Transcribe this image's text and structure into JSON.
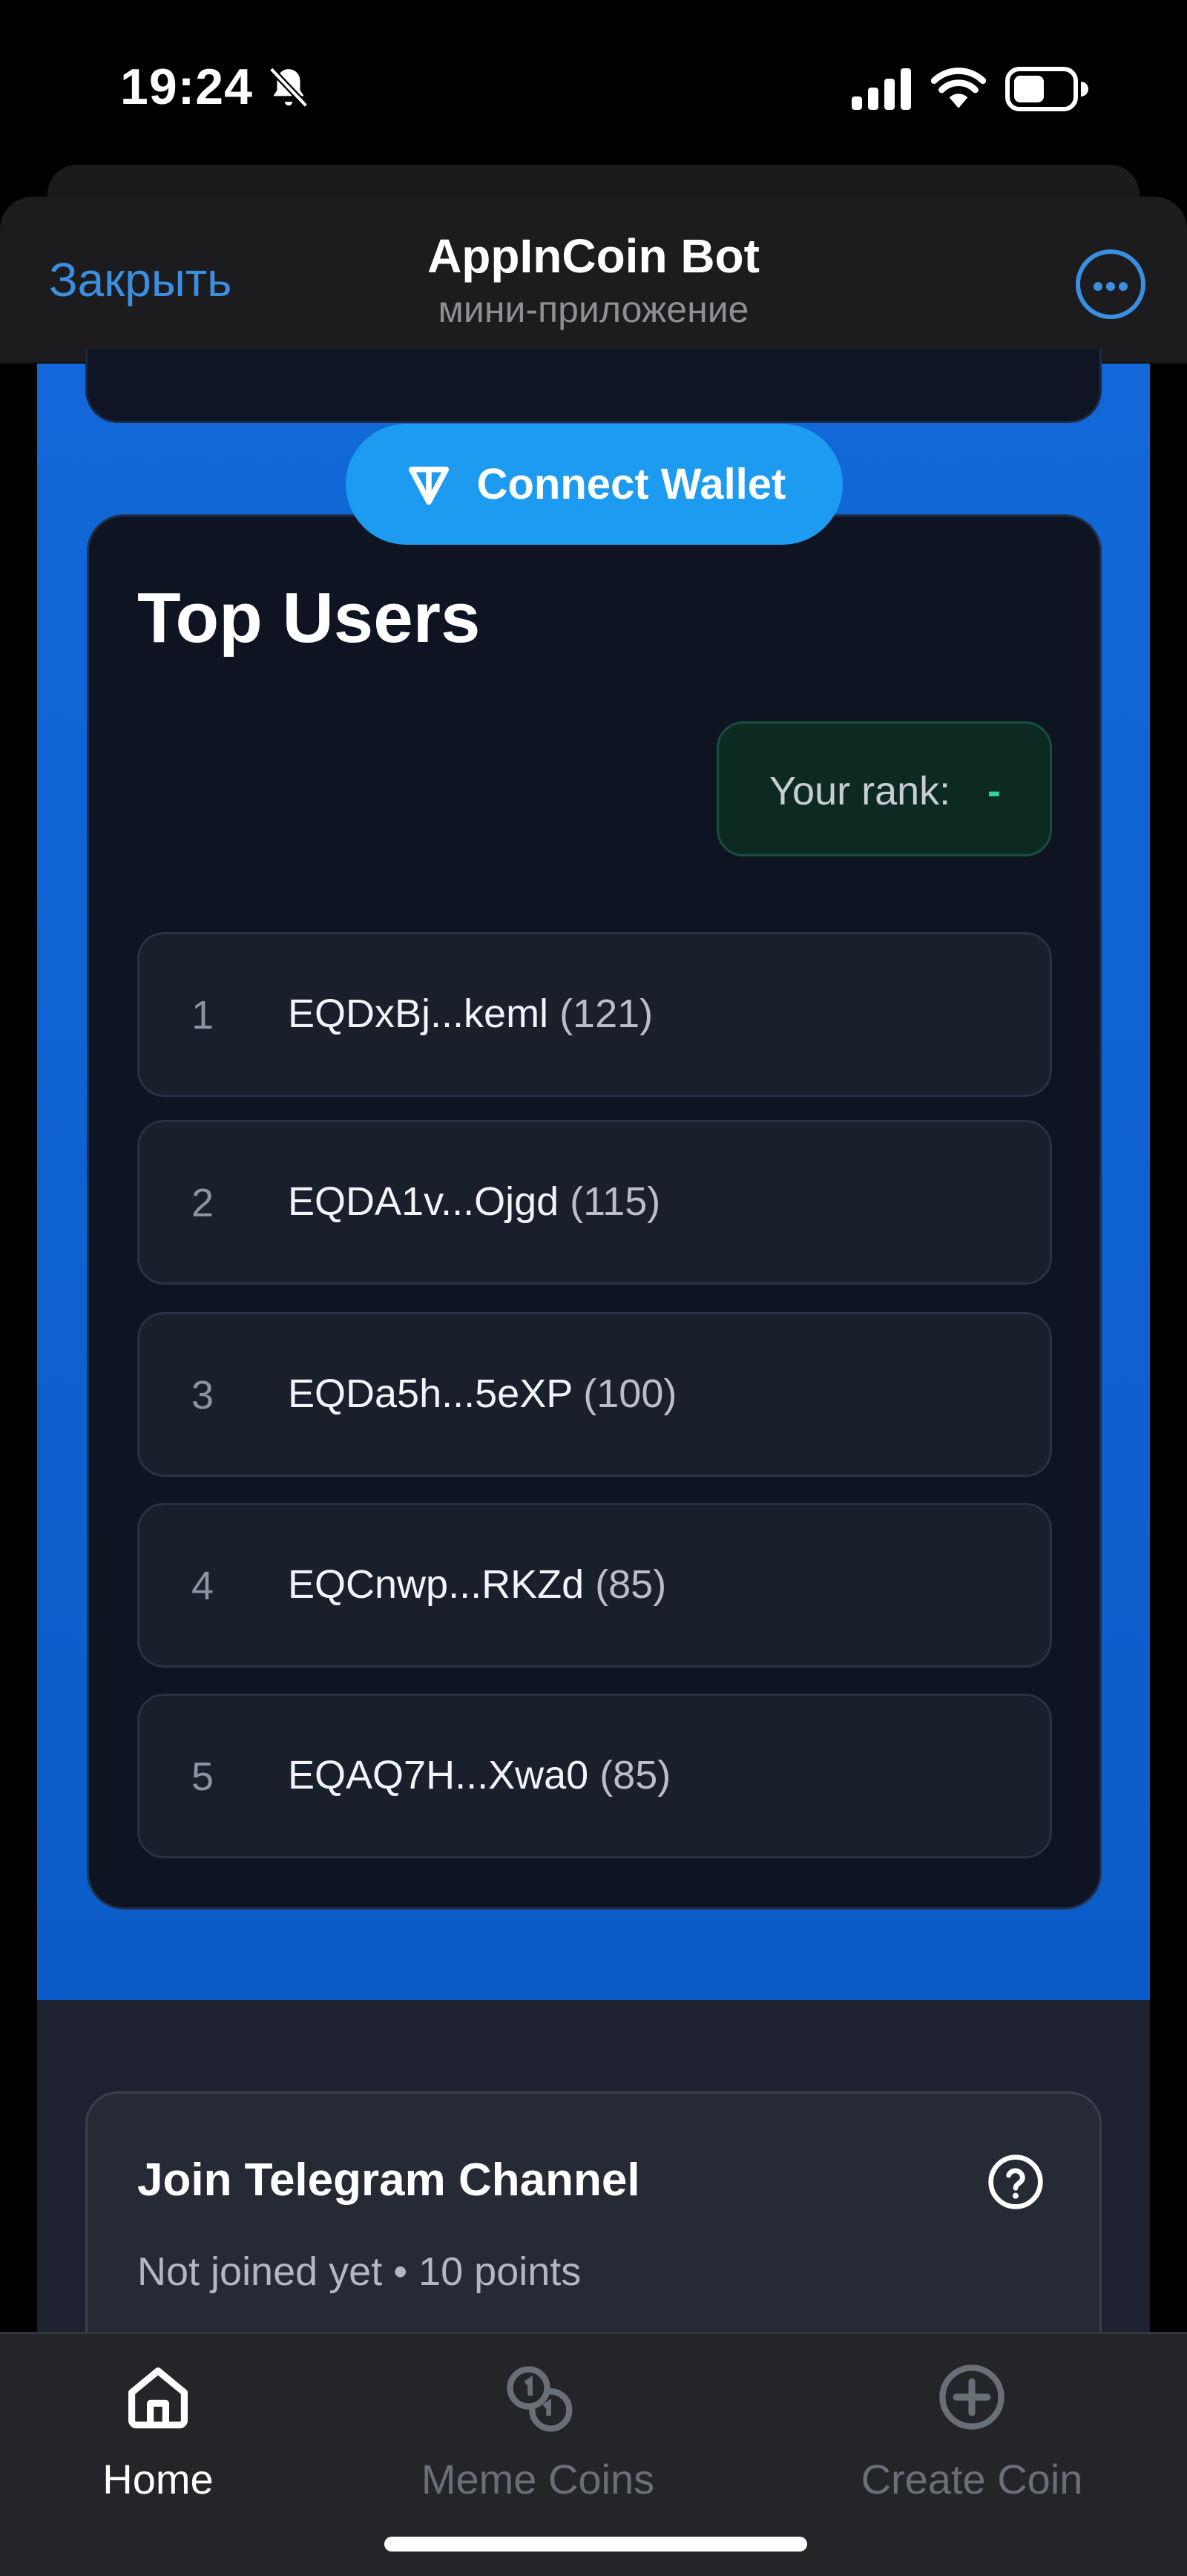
{
  "status_bar": {
    "time": "19:24",
    "icons": [
      "bell-muted-icon",
      "signal-icon",
      "wifi-icon",
      "battery-icon"
    ]
  },
  "header": {
    "close_label": "Закрыть",
    "title": "AppInCoin Bot",
    "subtitle": "мини-приложение",
    "more_icon": "ellipsis-circle-icon"
  },
  "wallet": {
    "connect_label": "Connect Wallet",
    "icon": "ton-icon"
  },
  "top_users": {
    "title": "Top Users",
    "rank_label": "Your rank:",
    "rank_value": "-",
    "users": [
      {
        "rank": "1",
        "address": "EQDxBj...keml",
        "score": "(121)"
      },
      {
        "rank": "2",
        "address": "EQDA1v...Ojgd",
        "score": "(115)"
      },
      {
        "rank": "3",
        "address": "EQDa5h...5eXP",
        "score": "(100)"
      },
      {
        "rank": "4",
        "address": "EQCnwp...RKZd",
        "score": "(85)"
      },
      {
        "rank": "5",
        "address": "EQAQ7H...Xwa0",
        "score": "(85)"
      }
    ]
  },
  "task": {
    "title": "Join Telegram Channel",
    "status": "Not joined yet • 10 points",
    "help_icon": "question-circle-icon"
  },
  "tabs": [
    {
      "label": "Home",
      "icon": "home-icon",
      "active": true
    },
    {
      "label": "Meme Coins",
      "icon": "coins-icon",
      "active": false
    },
    {
      "label": "Create Coin",
      "icon": "plus-circle-icon",
      "active": false
    }
  ],
  "colors": {
    "accent": "#1d9bf0",
    "link": "#3a8fe0",
    "background_blue": "#1268d8",
    "card": "#0f1423",
    "rank_green": "#34d399"
  }
}
